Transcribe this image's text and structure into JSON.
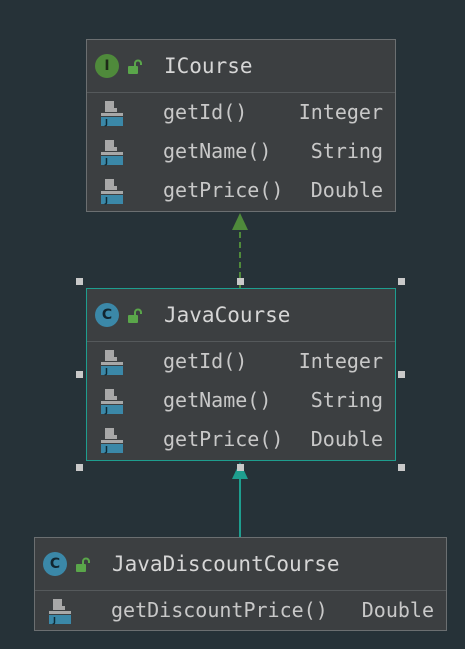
{
  "colors": {
    "background": "#263238",
    "node_fill": "#3c3f41",
    "selected_border": "#1e9e8f",
    "realization_edge": "#4f8a3b",
    "generalization_edge": "#1e9e8f"
  },
  "nodes": [
    {
      "kind": "interface",
      "badge": "I",
      "badge_icon": "interface-icon",
      "name": "ICourse",
      "members": [
        {
          "name": "getId()",
          "type": "Integer",
          "icon": "method-icon"
        },
        {
          "name": "getName()",
          "type": "String",
          "icon": "method-icon"
        },
        {
          "name": "getPrice()",
          "type": "Double",
          "icon": "method-icon"
        }
      ]
    },
    {
      "kind": "class",
      "badge": "C",
      "badge_icon": "class-icon",
      "name": "JavaCourse",
      "selected": true,
      "members": [
        {
          "name": "getId()",
          "type": "Integer",
          "icon": "method-icon"
        },
        {
          "name": "getName()",
          "type": "String",
          "icon": "method-icon"
        },
        {
          "name": "getPrice()",
          "type": "Double",
          "icon": "method-icon"
        }
      ]
    },
    {
      "kind": "class",
      "badge": "C",
      "badge_icon": "class-icon",
      "name": "JavaDiscountCourse",
      "members": [
        {
          "name": "getDiscountPrice()",
          "type": "Double",
          "icon": "method-icon"
        }
      ]
    }
  ],
  "edges": [
    {
      "type": "realization",
      "style": "dashed",
      "from": "JavaCourse",
      "to": "ICourse"
    },
    {
      "type": "generalization",
      "style": "solid",
      "from": "JavaDiscountCourse",
      "to": "JavaCourse"
    }
  ]
}
